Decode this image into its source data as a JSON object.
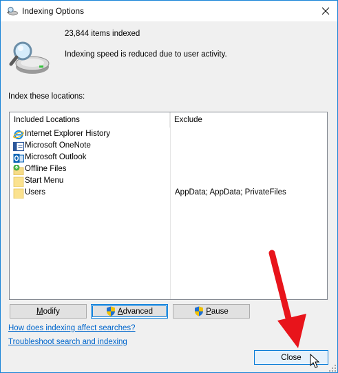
{
  "window": {
    "title": "Indexing Options",
    "close_icon": "close-icon"
  },
  "status": {
    "items_indexed": "23,844 items indexed",
    "message": "Indexing speed is reduced due to user activity."
  },
  "locations": {
    "section_label": "Index these locations:",
    "headers": {
      "included": "Included Locations",
      "exclude": "Exclude"
    },
    "rows": [
      {
        "name": "Internet Explorer History",
        "exclude": "",
        "icon": "internet-explorer-icon"
      },
      {
        "name": "Microsoft OneNote",
        "exclude": "",
        "icon": "onenote-icon"
      },
      {
        "name": "Microsoft Outlook",
        "exclude": "",
        "icon": "outlook-icon"
      },
      {
        "name": "Offline Files",
        "exclude": "",
        "icon": "offline-files-icon"
      },
      {
        "name": "Start Menu",
        "exclude": "",
        "icon": "folder-icon"
      },
      {
        "name": "Users",
        "exclude": "AppData; AppData; PrivateFiles",
        "icon": "folder-icon"
      }
    ]
  },
  "buttons": {
    "modify": "Modify",
    "advanced": "Advanced",
    "pause": "Pause",
    "close": "Close"
  },
  "links": {
    "how_affect": "How does indexing affect searches?",
    "troubleshoot": "Troubleshoot search and indexing"
  },
  "colors": {
    "window_border": "#1883d7",
    "link": "#0066cc",
    "annotation_arrow": "#e8141b"
  }
}
